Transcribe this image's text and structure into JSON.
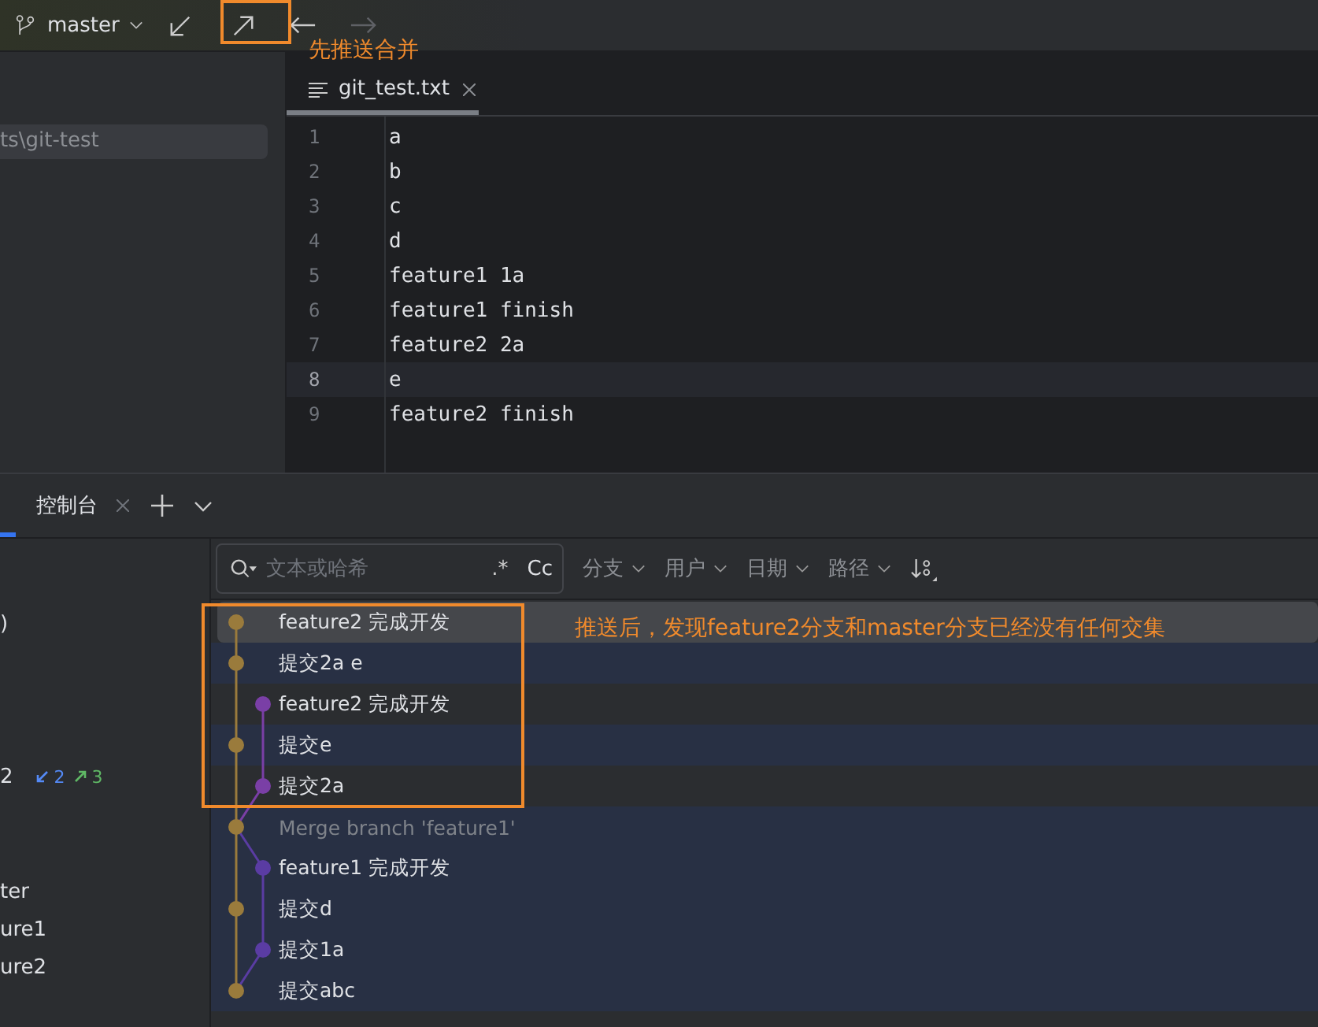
{
  "toolbar": {
    "branch": "master",
    "push_highlighted": true,
    "annotation": "先推送合并",
    "back_disabled": false,
    "forward_disabled": true
  },
  "project": {
    "path": "ts\\git-test"
  },
  "editor": {
    "tab": {
      "label": "git_test.txt",
      "selected": true
    },
    "lines": [
      {
        "number": "1",
        "text": "a",
        "current": false
      },
      {
        "number": "2",
        "text": "b",
        "current": false
      },
      {
        "number": "3",
        "text": "c",
        "current": false
      },
      {
        "number": "4",
        "text": "d",
        "current": false
      },
      {
        "number": "5",
        "text": "feature1 1a",
        "current": false
      },
      {
        "number": "6",
        "text": "feature1 finish",
        "current": false
      },
      {
        "number": "7",
        "text": "feature2 2a",
        "current": false
      },
      {
        "number": "8",
        "text": "e",
        "current": true
      },
      {
        "number": "9",
        "text": "feature2 finish",
        "current": false
      }
    ]
  },
  "tool_window": {
    "tabs": [
      {
        "label": "控制台",
        "selected": false
      }
    ]
  },
  "branches": [
    {
      "label": ")",
      "kind": "plain"
    },
    {
      "label": "2",
      "kind": "counts",
      "incoming": "2",
      "outgoing": "3"
    },
    {
      "label": "ter",
      "kind": "plain"
    },
    {
      "label": "ure1",
      "kind": "plain"
    },
    {
      "label": "ure2",
      "kind": "plain"
    }
  ],
  "filter": {
    "placeholder": "文本或哈希",
    "regex": ".*",
    "case": "Cc",
    "menus": [
      "分支",
      "用户",
      "日期",
      "路径"
    ]
  },
  "annotation": "推送后，发现feature2分支和master分支已经没有任何交集",
  "commits": [
    {
      "message": "feature2 完成开发",
      "kind": "main",
      "color": "#9a7b3c",
      "selected": true,
      "on_branch": false,
      "merge": false
    },
    {
      "message": "提交2a e",
      "kind": "main",
      "color": "#9a7b3c",
      "selected": false,
      "on_branch": true,
      "merge": false
    },
    {
      "message": "feature2 完成开发",
      "kind": "side",
      "color": "#7a3fa6",
      "selected": false,
      "on_branch": false,
      "merge": false
    },
    {
      "message": "提交e",
      "kind": "main",
      "color": "#9a7b3c",
      "selected": false,
      "on_branch": true,
      "merge": false
    },
    {
      "message": "提交2a",
      "kind": "side",
      "color": "#7a3fa6",
      "selected": false,
      "on_branch": false,
      "merge": false
    },
    {
      "message": "Merge branch 'feature1'",
      "kind": "main",
      "color": "#9a7b3c",
      "selected": false,
      "on_branch": true,
      "merge": true
    },
    {
      "message": "feature1 完成开发",
      "kind": "side",
      "color": "#5a3ca3",
      "selected": false,
      "on_branch": true,
      "merge": false
    },
    {
      "message": "提交d",
      "kind": "main",
      "color": "#9a7b3c",
      "selected": false,
      "on_branch": true,
      "merge": false
    },
    {
      "message": "提交1a",
      "kind": "side",
      "color": "#5a3ca3",
      "selected": false,
      "on_branch": true,
      "merge": false
    },
    {
      "message": "提交abc",
      "kind": "main",
      "color": "#9a7b3c",
      "selected": false,
      "on_branch": true,
      "merge": false
    }
  ]
}
